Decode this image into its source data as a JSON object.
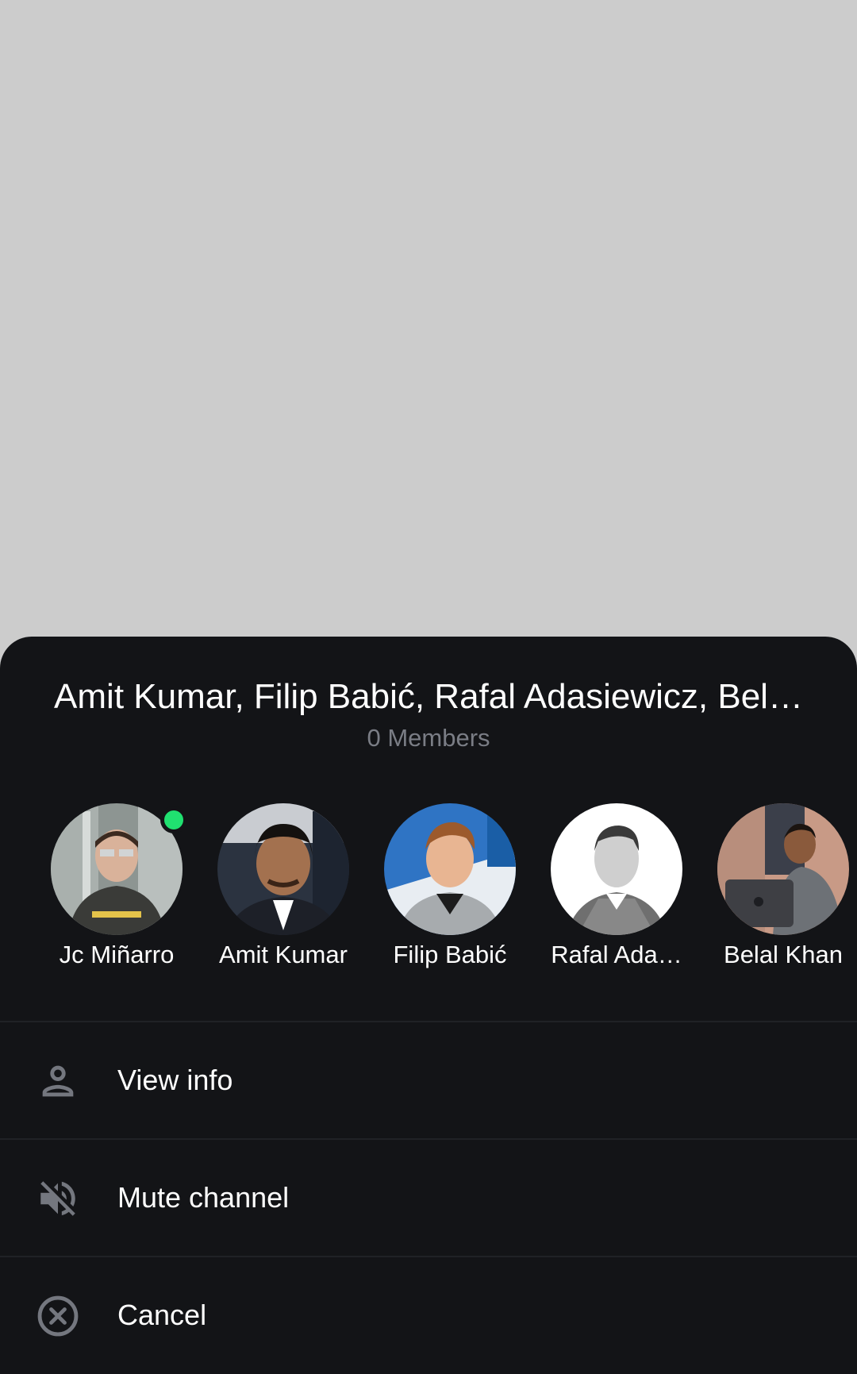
{
  "sheet": {
    "title": "Amit Kumar, Filip Babić, Rafal Adasiewicz, Bel…",
    "subtitle": "0 Members"
  },
  "members": [
    {
      "name": "Jc Miñarro",
      "online": true
    },
    {
      "name": "Amit Kumar",
      "online": false
    },
    {
      "name": "Filip Babić",
      "online": false
    },
    {
      "name": "Rafal Ada…",
      "online": false
    },
    {
      "name": "Belal Khan",
      "online": false
    }
  ],
  "menu": {
    "view_info": {
      "label": "View info",
      "icon": "person-icon"
    },
    "mute_channel": {
      "label": "Mute channel",
      "icon": "volume-off-icon"
    },
    "cancel": {
      "label": "Cancel",
      "icon": "cancel-circle-icon"
    }
  },
  "colors": {
    "sheet_bg": "#131417",
    "scrim": "#cccccc",
    "online": "#20e070",
    "subtitle": "#7a7d85",
    "icon": "#74777f"
  }
}
